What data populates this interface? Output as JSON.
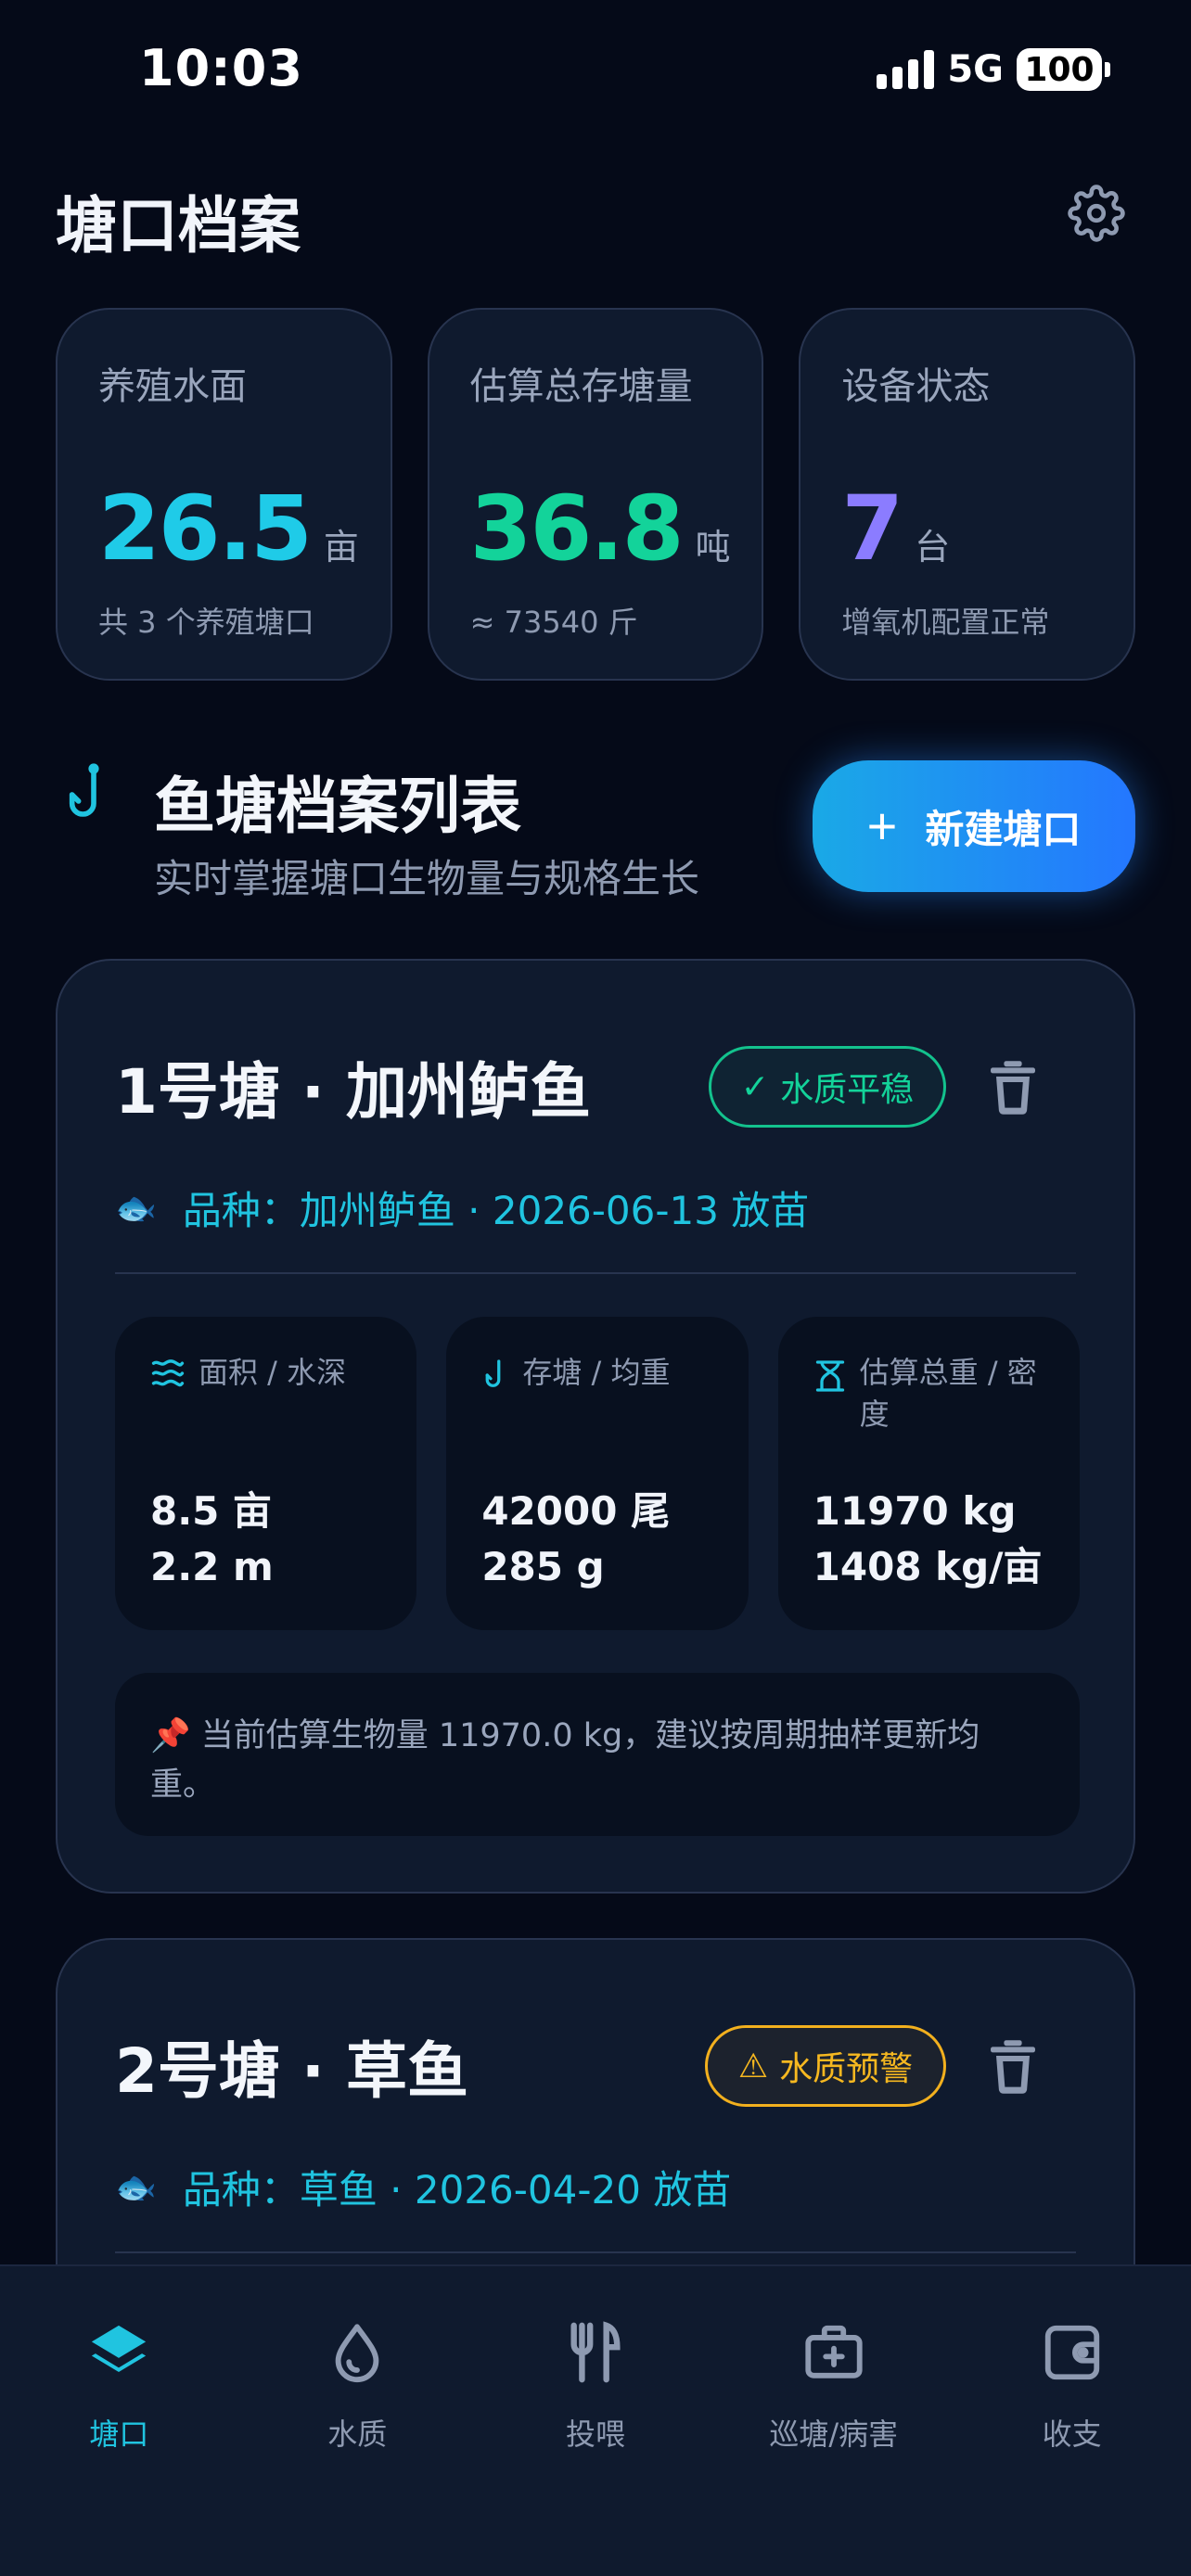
{
  "status_bar": {
    "time": "10:03",
    "network": "5G",
    "battery": "100"
  },
  "header": {
    "title": "塘口档案"
  },
  "summary": [
    {
      "label": "养殖水面",
      "value": "26.5",
      "unit": "亩",
      "sub": "共 3 个养殖塘口",
      "color": "#1fcbe8"
    },
    {
      "label": "估算总存塘量",
      "value": "36.8",
      "unit": "吨",
      "sub": "≈ 73540 斤",
      "color": "#13d39a"
    },
    {
      "label": "设备状态",
      "value": "7",
      "unit": "台",
      "sub": "增氧机配置正常",
      "color": "#8b7cff"
    }
  ],
  "section": {
    "title": "鱼塘档案列表",
    "subtitle": "实时掌握塘口生物量与规格生长",
    "new_button": "新建塘口"
  },
  "ponds": [
    {
      "title": "1号塘 · 加州鲈鱼",
      "badge": "水质平稳",
      "badge_icon": "✓",
      "species": "品种：加州鲈鱼 · 2026-06-13 放苗",
      "metrics": [
        {
          "label": "面积 / 水深",
          "line1": "8.5 亩",
          "line2": "2.2 m"
        },
        {
          "label": "存塘 / 均重",
          "line1": "42000 尾",
          "line2": "285 g"
        },
        {
          "label": "估算总重 / 密度",
          "line1": "11970 kg",
          "line2": "1408 kg/亩"
        }
      ],
      "note": "当前估算生物量 11970.0 kg，建议按周期抽样更新均重。"
    },
    {
      "title": "2号塘 · 草鱼",
      "badge": "水质预警",
      "badge_icon": "⚠",
      "species": "品种：草鱼 · 2026-04-20 放苗"
    }
  ],
  "nav": [
    {
      "label": "塘口",
      "icon": "layers-icon",
      "active": true
    },
    {
      "label": "水质",
      "icon": "droplet-icon",
      "active": false
    },
    {
      "label": "投喂",
      "icon": "utensils-icon",
      "active": false
    },
    {
      "label": "巡塘/病害",
      "icon": "first-aid-kit-icon",
      "active": false
    },
    {
      "label": "收支",
      "icon": "wallet-icon",
      "active": false
    }
  ],
  "colors": {
    "accent": "#20c4e0",
    "button": "#2477ff",
    "ok": "#13c28d",
    "warn": "#f2b01e"
  }
}
